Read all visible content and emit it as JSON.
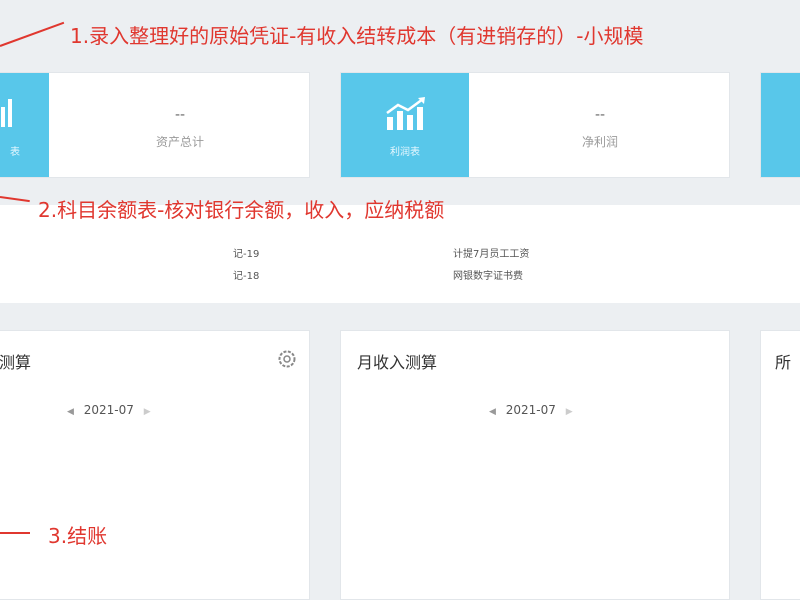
{
  "cards": [
    {
      "tile_label": "表",
      "value": "--",
      "label": "资产总计",
      "icon": "chart-icon"
    },
    {
      "tile_label": "利润表",
      "value": "--",
      "label": "净利润",
      "icon": "bar-chart-up-icon"
    },
    {
      "tile_label": "",
      "value": "",
      "label": "",
      "icon": ""
    }
  ],
  "vouchers": [
    {
      "no": "记-19",
      "desc": "计提7月员工工资"
    },
    {
      "no": "记-18",
      "desc": "网银数字证书费"
    }
  ],
  "panels": [
    {
      "title": "测算",
      "date": "2021-07"
    },
    {
      "title": "月收入测算",
      "date": "2021-07"
    },
    {
      "title": "所"
    }
  ],
  "annotations": {
    "step1": "1.录入整理好的原始凭证-有收入结转成本（有进销存的）-小规模",
    "step2": "2.科目余额表-核对银行余额，收入，应纳税额",
    "step3": "3.结账"
  },
  "colors": {
    "tile": "#58c7ea",
    "annotation": "#e0372f",
    "background": "#eceff2"
  }
}
